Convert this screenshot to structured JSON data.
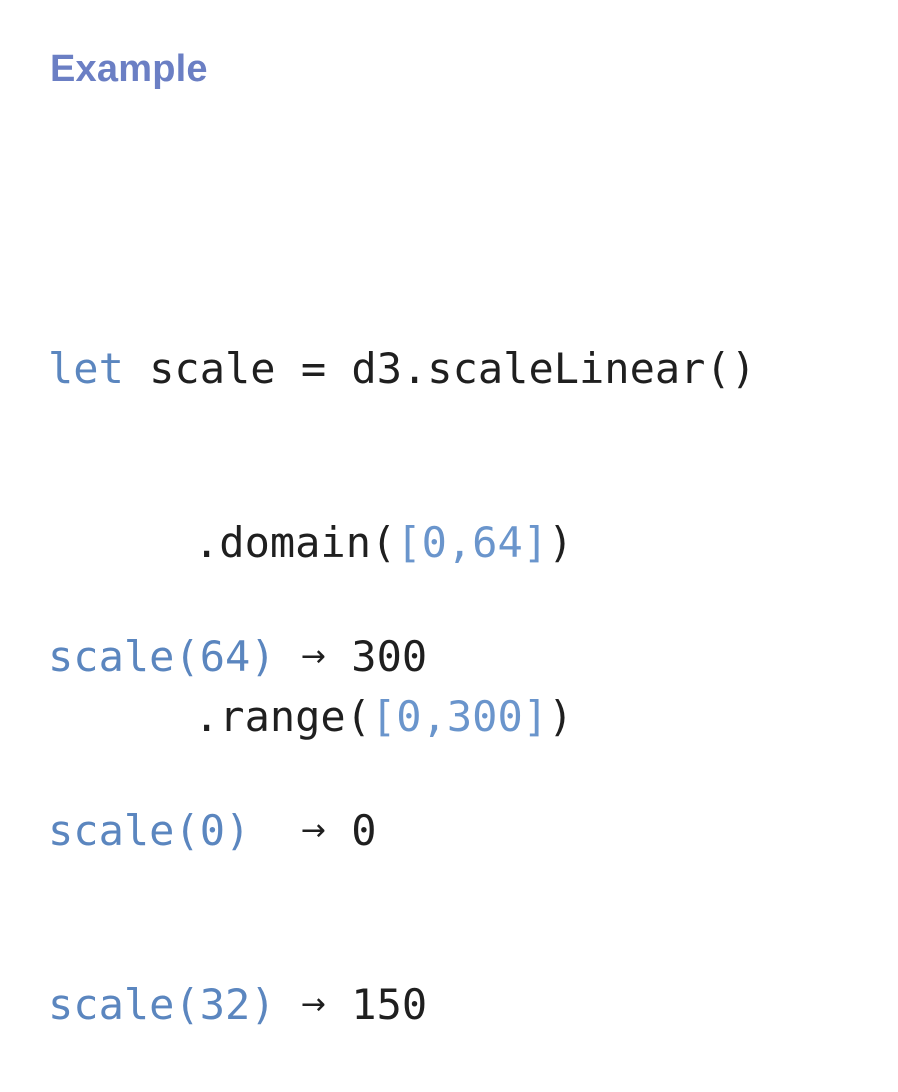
{
  "colors": {
    "title": "#6b7fc4",
    "keyword": "#5b86bf",
    "literal": "#6a95cc",
    "text": "#1f1f1f"
  },
  "title": "Example",
  "code": {
    "line1": {
      "keyword": "let",
      "rest": " scale = d3.scaleLinear()"
    },
    "line2": {
      "method": ".domain(",
      "literal": "[0,64]",
      "close": ")"
    },
    "line3": {
      "method": ".range(",
      "literal": "[0,300]",
      "close": ")"
    }
  },
  "results": [
    {
      "call": "scale(64)",
      "gap": " ",
      "arrow": "→",
      "value": " 300"
    },
    {
      "call": "scale(0)",
      "gap": "  ",
      "arrow": "→",
      "value": " 0"
    },
    {
      "call": "scale(32)",
      "gap": " ",
      "arrow": "→",
      "value": " 150"
    }
  ]
}
